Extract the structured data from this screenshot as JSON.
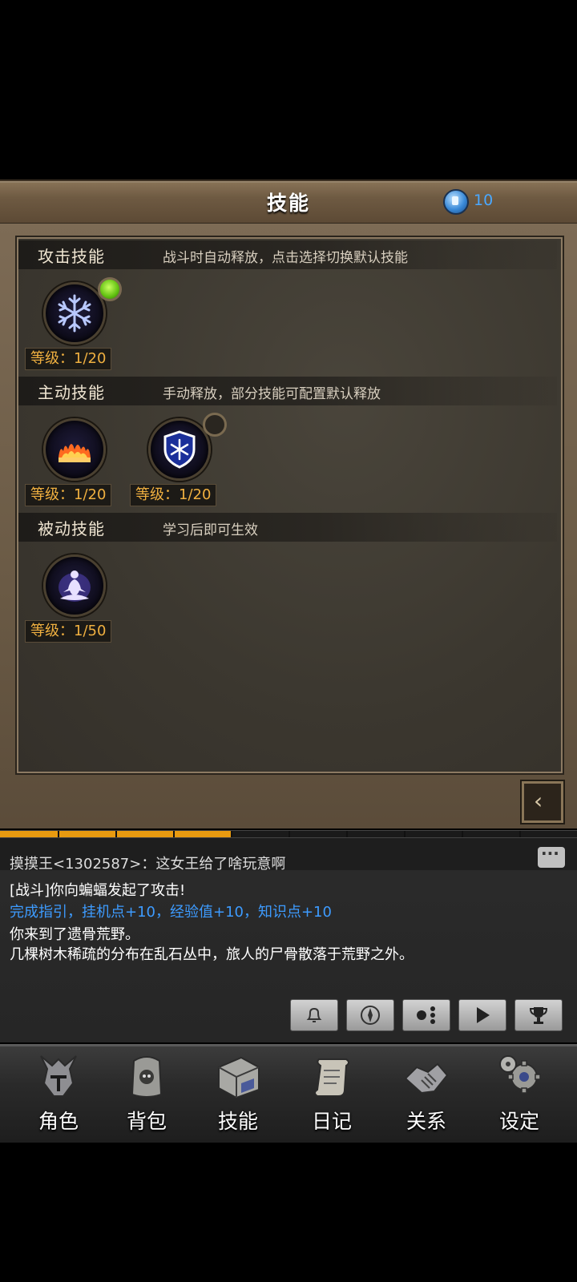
{
  "header": {
    "title": "技能",
    "currency_icon": "blue-book-icon",
    "currency_value": "10"
  },
  "sections": [
    {
      "name": "攻击技能",
      "desc": "战斗时自动释放，点击选择切换默认技能",
      "skills": [
        {
          "icon": "snowflake-icon",
          "level": "等级：1/20",
          "default": true
        }
      ]
    },
    {
      "name": "主动技能",
      "desc": "手动释放，部分技能可配置默认释放",
      "skills": [
        {
          "icon": "fire-icon",
          "level": "等级：1/20"
        },
        {
          "icon": "ice-shield-icon",
          "level": "等级：1/20",
          "default": false
        }
      ]
    },
    {
      "name": "被动技能",
      "desc": "学习后即可生效",
      "skills": [
        {
          "icon": "meditation-icon",
          "level": "等级：1/50"
        }
      ]
    }
  ],
  "progress": {
    "filled_segments": 4,
    "total_segments": 10
  },
  "chat": {
    "lines": [
      {
        "text": "摸摸王<1302587>：这女王给了啥玩意啊",
        "color": "#dddddd"
      },
      {
        "text": "[战斗]你向蝙蝠发起了攻击!",
        "color": "#ffffff"
      },
      {
        "text": "完成指引，挂机点+10，经验值+10，知识点+10",
        "color": "#3d9bff"
      },
      {
        "text": "你来到了遗骨荒野。",
        "color": "#ffffff"
      },
      {
        "text": "几棵树木稀疏的分布在乱石丛中，旅人的尸骨散落于荒野之外。",
        "color": "#ffffff"
      }
    ],
    "tools": [
      "bell-icon",
      "compass-icon",
      "dots-icon",
      "play-icon",
      "trophy-icon"
    ]
  },
  "nav": [
    {
      "label": "角色",
      "icon": "helmet-icon"
    },
    {
      "label": "背包",
      "icon": "backpack-icon"
    },
    {
      "label": "技能",
      "icon": "spellbook-icon"
    },
    {
      "label": "日记",
      "icon": "scroll-icon"
    },
    {
      "label": "关系",
      "icon": "handshake-icon"
    },
    {
      "label": "设定",
      "icon": "gears-icon"
    }
  ]
}
